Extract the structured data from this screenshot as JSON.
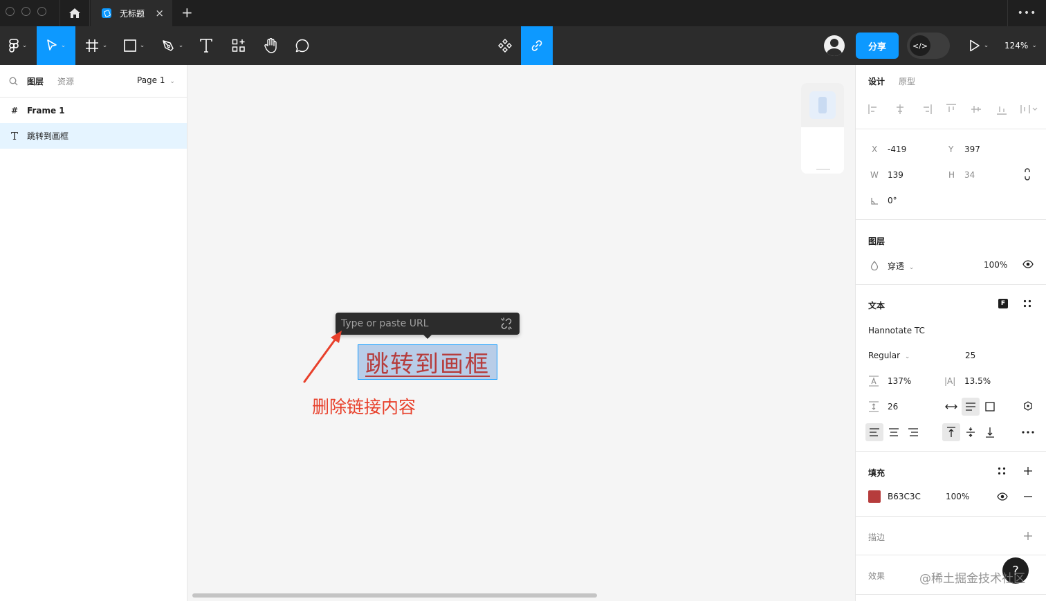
{
  "titlebar": {
    "file_tab_title": "无标题",
    "close_glyph": "×",
    "new_tab_glyph": "+",
    "more_glyph": "•••"
  },
  "toolbar": {
    "share_label": "分享",
    "zoom_label": "124%",
    "dev_mode_glyph": "</>",
    "accent_color": "#0d99ff"
  },
  "left_panel": {
    "tabs": [
      "图层",
      "资源"
    ],
    "page_label": "Page 1",
    "layers": [
      {
        "icon": "frame-icon",
        "glyph": "#",
        "name": "Frame 1",
        "selected": false
      },
      {
        "icon": "text-icon",
        "glyph": "T",
        "name": "跳转到画框",
        "selected": true
      }
    ]
  },
  "canvas": {
    "url_placeholder": "Type or paste URL",
    "selected_text": "跳转到画框",
    "annotation": "删除链接内容",
    "annotation_color": "#e8402b"
  },
  "right_panel": {
    "tabs": [
      "设计",
      "原型"
    ],
    "geometry": {
      "x_label": "X",
      "x_value": "-419",
      "y_label": "Y",
      "y_value": "397",
      "w_label": "W",
      "w_value": "139",
      "h_label": "H",
      "h_value": "34",
      "rotation": "0°"
    },
    "layer": {
      "title": "图层",
      "blend_mode": "穿透",
      "opacity": "100%"
    },
    "text": {
      "title": "文本",
      "font_family": "Hannotate TC",
      "font_style": "Regular",
      "font_size": "25",
      "line_height": "137%",
      "letter_spacing_label": "|A|",
      "letter_spacing": "13.5%",
      "paragraph_spacing": "26"
    },
    "fill": {
      "title": "填充",
      "color_hex": "B63C3C",
      "swatch_color": "#b63c3c",
      "opacity": "100%"
    },
    "stroke": {
      "title": "描边"
    },
    "effects": {
      "title": "效果"
    },
    "help_glyph": "?",
    "watermark": "@稀土掘金技术社区"
  }
}
